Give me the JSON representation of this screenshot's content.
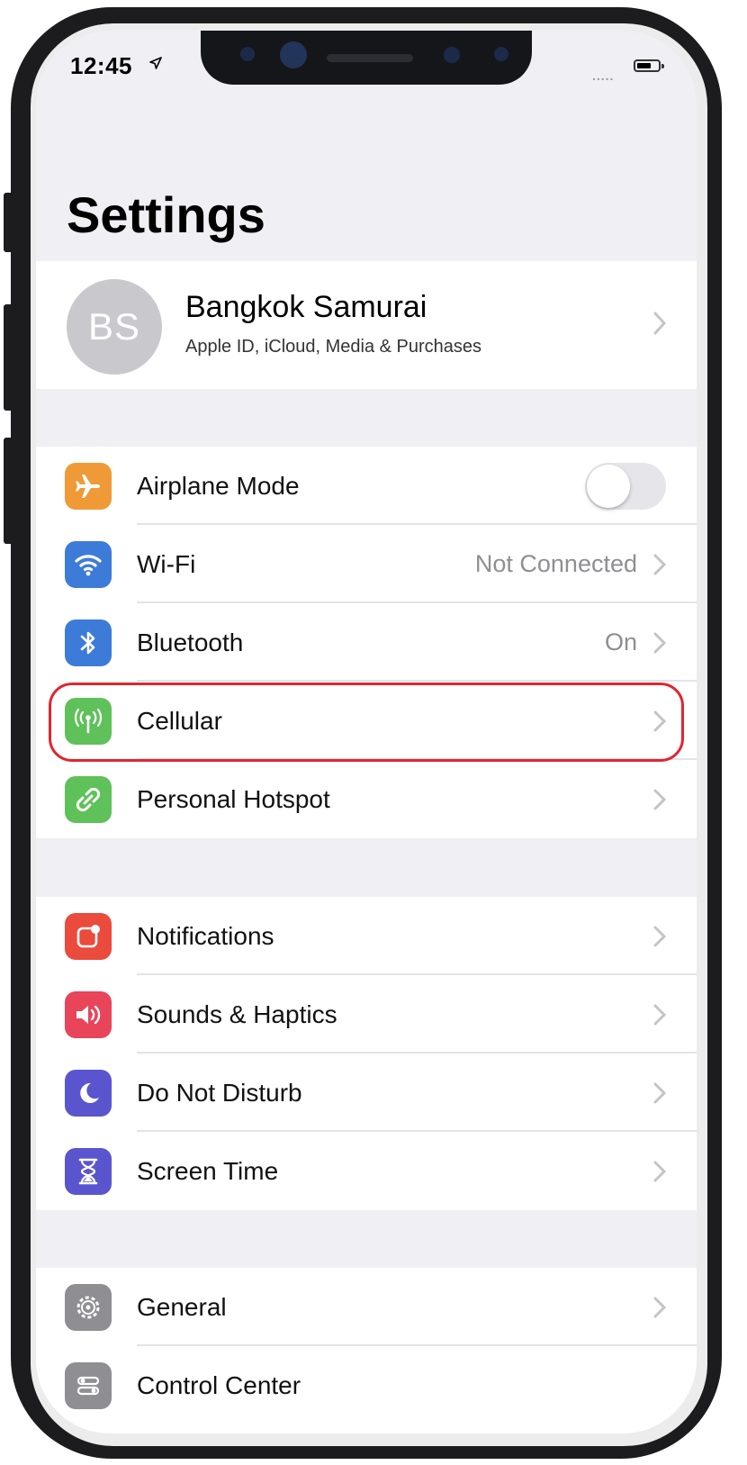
{
  "status_bar": {
    "time": "12:45",
    "signal": "....."
  },
  "header": {
    "title": "Settings"
  },
  "profile": {
    "initials": "BS",
    "name": "Bangkok Samurai",
    "subtitle": "Apple ID, iCloud, Media & Purchases"
  },
  "connectivity": [
    {
      "label": "Airplane Mode",
      "icon": "airplane-icon",
      "color": "#f09a37",
      "toggle": false
    },
    {
      "label": "Wi-Fi",
      "icon": "wifi-icon",
      "color": "#3d7bd8",
      "value": "Not Connected"
    },
    {
      "label": "Bluetooth",
      "icon": "bluetooth-icon",
      "color": "#3d7bd8",
      "value": "On"
    },
    {
      "label": "Cellular",
      "icon": "cellular-antenna-icon",
      "color": "#5fc15a",
      "highlighted": true
    },
    {
      "label": "Personal Hotspot",
      "icon": "hotspot-icon",
      "color": "#5fc15a"
    }
  ],
  "alerts": [
    {
      "label": "Notifications",
      "icon": "notifications-icon",
      "color": "#ea4b3d"
    },
    {
      "label": "Sounds & Haptics",
      "icon": "speaker-icon",
      "color": "#e8445a"
    },
    {
      "label": "Do Not Disturb",
      "icon": "moon-icon",
      "color": "#5a55cf"
    },
    {
      "label": "Screen Time",
      "icon": "hourglass-icon",
      "color": "#5a55cf"
    }
  ],
  "general": [
    {
      "label": "General",
      "icon": "gear-icon",
      "color": "#8e8e93"
    },
    {
      "label": "Control Center",
      "icon": "control-center-icon",
      "color": "#8e8e93"
    }
  ],
  "highlight_color": "#e0262f"
}
